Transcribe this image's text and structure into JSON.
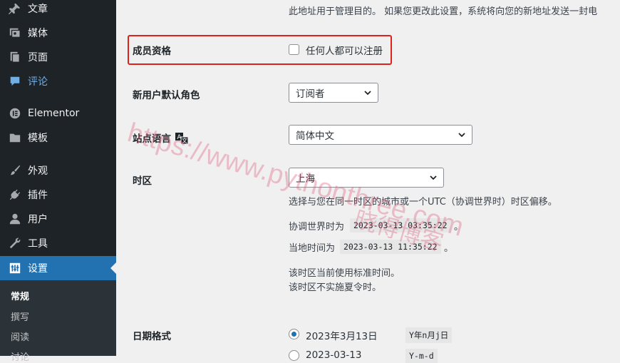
{
  "sidebar": {
    "items": [
      {
        "label": "文章",
        "icon": "pin-icon"
      },
      {
        "label": "媒体",
        "icon": "media-icon"
      },
      {
        "label": "页面",
        "icon": "pages-icon"
      },
      {
        "label": "评论",
        "icon": "comment-icon"
      },
      {
        "label": "Elementor",
        "icon": "elementor-icon"
      },
      {
        "label": "模板",
        "icon": "folder-icon"
      },
      {
        "label": "外观",
        "icon": "brush-icon"
      },
      {
        "label": "插件",
        "icon": "plugin-icon"
      },
      {
        "label": "用户",
        "icon": "user-icon"
      },
      {
        "label": "工具",
        "icon": "wrench-icon"
      },
      {
        "label": "设置",
        "icon": "settings-icon"
      }
    ],
    "submenu": [
      "常规",
      "撰写",
      "阅读",
      "讨论"
    ]
  },
  "admin_email_desc": "此地址用于管理目的。 如果您更改此设置，系统将向您的新地址发送一封电",
  "membership": {
    "label": "成员资格",
    "checkbox_label": "任何人都可以注册"
  },
  "default_role": {
    "label": "新用户默认角色",
    "value": "订阅者"
  },
  "site_language": {
    "label": "站点语言",
    "value": "简体中文"
  },
  "timezone": {
    "label": "时区",
    "value": "上海",
    "desc": "选择与您在同一时区的城市或一个UTC（协调世界时）时区偏移。",
    "utc_prefix": "协调世界时为",
    "utc_time": "2023-03-13 03:35:22",
    "local_prefix": "当地时间为",
    "local_time": "2023-03-13 11:35:22",
    "period": "。",
    "note1": "该时区当前使用标准时间。",
    "note2": "该时区不实施夏令时。"
  },
  "date_format": {
    "label": "日期格式",
    "options": [
      {
        "display": "2023年3月13日",
        "format": "Y年n月j日",
        "selected": true
      },
      {
        "display": "2023-03-13",
        "format": "Y-m-d",
        "selected": false
      }
    ]
  },
  "watermark": {
    "url": "https://www.pythonthree.com",
    "name": "晓得博客"
  },
  "colors": {
    "sidebar": "#1d2327",
    "accent": "#2271b1",
    "highlight": "#e0221d"
  }
}
